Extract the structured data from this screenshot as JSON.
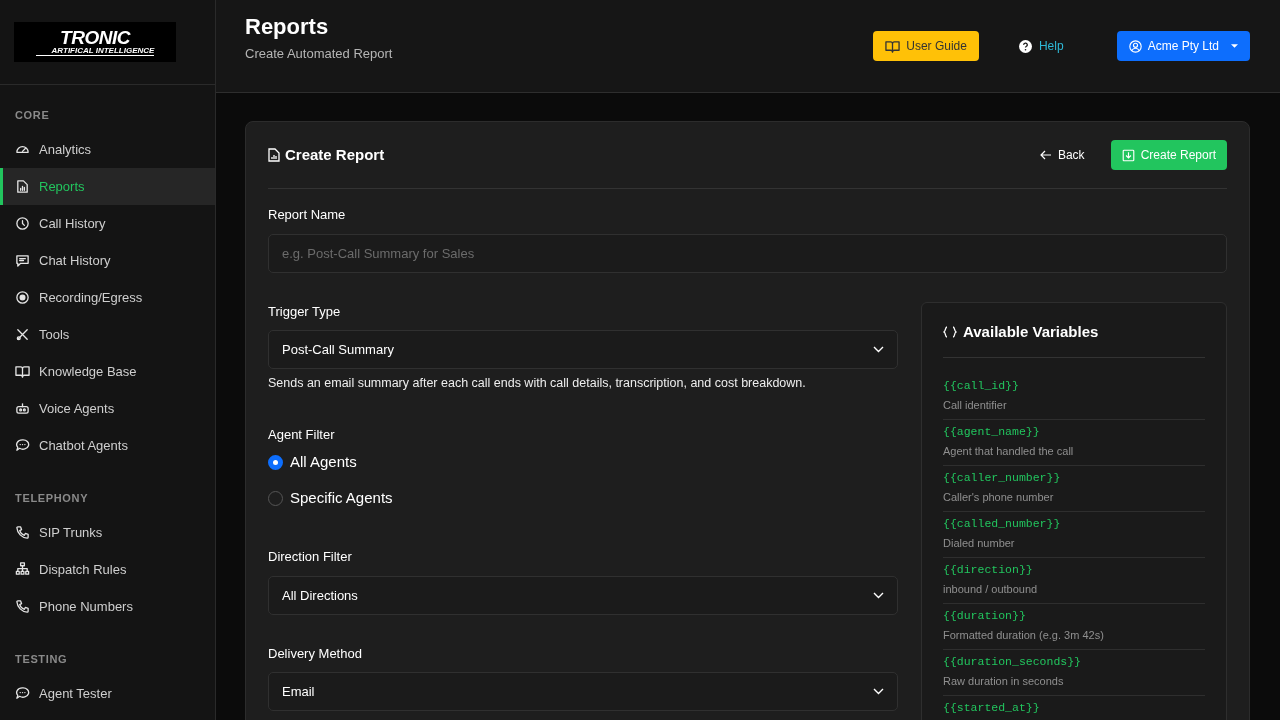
{
  "logo": {
    "wordmark": "TRONIC",
    "tagline": "ARTIFICAL INTELLIGENCE"
  },
  "sidebar": {
    "sections": [
      {
        "heading": "CORE",
        "items": [
          {
            "label": "Analytics",
            "selected": false
          },
          {
            "label": "Reports",
            "selected": true
          },
          {
            "label": "Call History",
            "selected": false
          },
          {
            "label": "Chat History",
            "selected": false
          },
          {
            "label": "Recording/Egress",
            "selected": false
          },
          {
            "label": "Tools",
            "selected": false
          },
          {
            "label": "Knowledge Base",
            "selected": false
          },
          {
            "label": "Voice Agents",
            "selected": false
          },
          {
            "label": "Chatbot Agents",
            "selected": false
          }
        ]
      },
      {
        "heading": "TELEPHONY",
        "items": [
          {
            "label": "SIP Trunks",
            "selected": false
          },
          {
            "label": "Dispatch Rules",
            "selected": false
          },
          {
            "label": "Phone Numbers",
            "selected": false
          }
        ]
      },
      {
        "heading": "TESTING",
        "items": [
          {
            "label": "Agent Tester",
            "selected": false
          }
        ]
      }
    ]
  },
  "header": {
    "title": "Reports",
    "subtitle": "Create Automated Report",
    "user_guide": "User Guide",
    "help": "Help",
    "account": "Acme Pty Ltd"
  },
  "card": {
    "title": "Create Report",
    "back": "Back",
    "create": "Create Report",
    "report_name": {
      "label": "Report Name",
      "placeholder": "e.g. Post-Call Summary for Sales"
    },
    "trigger": {
      "label": "Trigger Type",
      "value": "Post-Call Summary",
      "description": "Sends an email summary after each call ends with call details, transcription, and cost breakdown."
    },
    "agent_filter": {
      "label": "Agent Filter",
      "options": [
        {
          "label": "All Agents",
          "selected": true
        },
        {
          "label": "Specific Agents",
          "selected": false
        }
      ]
    },
    "direction": {
      "label": "Direction Filter",
      "value": "All Directions"
    },
    "delivery": {
      "label": "Delivery Method",
      "value": "Email"
    },
    "variables": {
      "title": "Available Variables",
      "items": [
        {
          "name": "{{call_id}}",
          "description": "Call identifier"
        },
        {
          "name": "{{agent_name}}",
          "description": "Agent that handled the call"
        },
        {
          "name": "{{caller_number}}",
          "description": "Caller's phone number"
        },
        {
          "name": "{{called_number}}",
          "description": "Dialed number"
        },
        {
          "name": "{{direction}}",
          "description": "inbound / outbound"
        },
        {
          "name": "{{duration}}",
          "description": "Formatted duration (e.g. 3m 42s)"
        },
        {
          "name": "{{duration_seconds}}",
          "description": "Raw duration in seconds"
        },
        {
          "name": "{{started_at}}"
        }
      ]
    }
  }
}
